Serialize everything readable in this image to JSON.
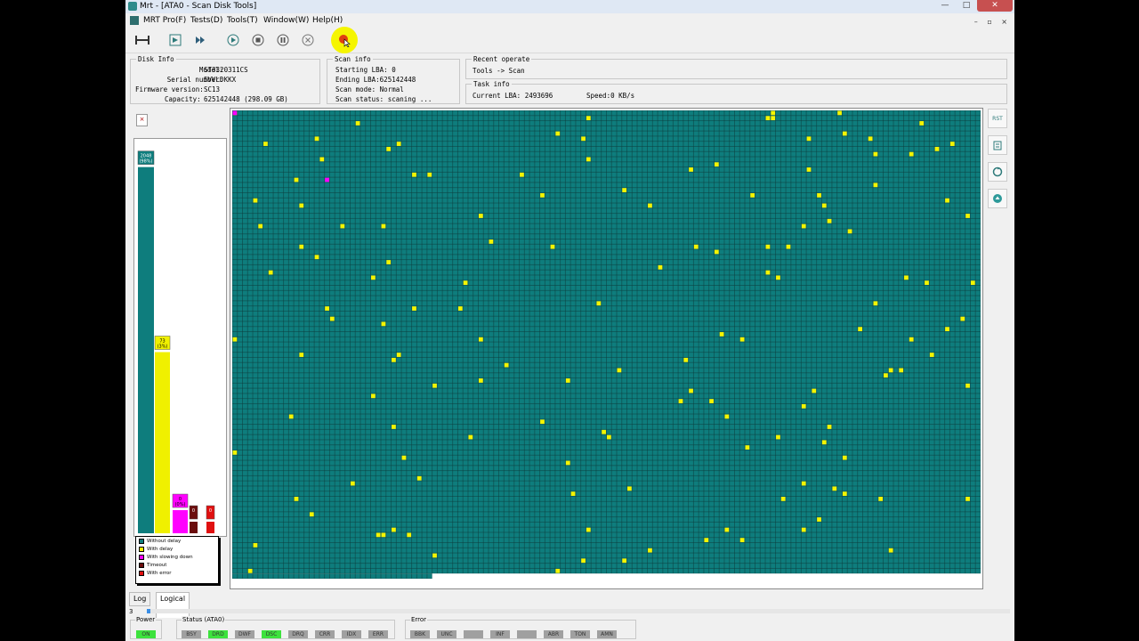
{
  "window": {
    "title": "Mrt - [ATA0 - Scan Disk Tools]",
    "controls": {
      "minimize": "—",
      "maximize": "□",
      "close": "✕"
    }
  },
  "menu": {
    "items": [
      "MRT Pro(F)",
      "Tests(D)",
      "Tools(T)",
      "Window(W)",
      "Help(H)"
    ],
    "mdi_controls": "– ▫ ×"
  },
  "disk_info": {
    "title": "Disk Info",
    "rows": [
      {
        "label": "Model:",
        "value": "ST3320311CS"
      },
      {
        "label": "Serial number:",
        "value": "5VVLDKKX"
      },
      {
        "label": "Firmware version:",
        "value": "SC13"
      },
      {
        "label": "Capacity:",
        "value": "625142448  (298.09 GB)"
      }
    ]
  },
  "scan_info": {
    "title": "Scan info",
    "rows": [
      "Starting LBA: 0",
      "Ending LBA:625142448",
      "Scan mode: Normal",
      "Scan status:  scaning ..."
    ]
  },
  "recent_operate": {
    "title": "Recent operate",
    "text": "Tools -> Scan"
  },
  "task_info": {
    "title": "Task info",
    "current_lba": "Current LBA: 2493696",
    "speed": "Speed:0 KB/s"
  },
  "histogram": {
    "bars": [
      {
        "name": "without-delay",
        "label": "2048\n(98%)",
        "color": "#0e7d7d",
        "level": 0.95
      },
      {
        "name": "with-delay",
        "label": "73\n(3%)",
        "color": "#f0f000",
        "level": 0.47
      },
      {
        "name": "slowing-down",
        "label": "0\n(0%)",
        "color": "#ff00ff",
        "level": 0.06
      },
      {
        "name": "timeout",
        "label": "0",
        "color": "#6b0d0d",
        "level": 0.03
      },
      {
        "name": "error",
        "label": "0",
        "color": "#e01010",
        "level": 0.03
      }
    ]
  },
  "legend": [
    {
      "label": "Without delay",
      "color": "#0e7d7d"
    },
    {
      "label": "With delay",
      "color": "#f0f000"
    },
    {
      "label": "With slowing down",
      "color": "#ff00ff"
    },
    {
      "label": "Timeout",
      "color": "#6b0d0d"
    },
    {
      "label": "With error",
      "color": "#e01010"
    }
  ],
  "scan_grid": {
    "colors": {
      "ok": "#0e7d7d",
      "delay": "#f5f500",
      "slow": "#ff00ff",
      "empty": "#ffffff"
    },
    "yellow_fraction": 0.01,
    "magenta_cells": [
      [
        0,
        0
      ],
      [
        18,
        13
      ]
    ]
  },
  "right_buttons": [
    "RST",
    "edit",
    "refresh",
    "eject"
  ],
  "tabs": [
    {
      "label": "Log"
    },
    {
      "label": "Logical scan"
    }
  ],
  "progress": {
    "text": "3",
    "fraction": 0.004
  },
  "status": {
    "power": {
      "title": "Power",
      "lamps": [
        {
          "label": "ON",
          "on": true
        }
      ]
    },
    "ata": {
      "title": "Status (ATA0)",
      "lamps": [
        {
          "label": "BSY",
          "on": false
        },
        {
          "label": "DRD",
          "on": true
        },
        {
          "label": "DWF",
          "on": false
        },
        {
          "label": "DSC",
          "on": true
        },
        {
          "label": "DRQ",
          "on": false
        },
        {
          "label": "CRR",
          "on": false
        },
        {
          "label": "IDX",
          "on": false
        },
        {
          "label": "ERR",
          "on": false
        }
      ]
    },
    "error": {
      "title": "Error",
      "lamps": [
        {
          "label": "BBK",
          "on": false
        },
        {
          "label": "UNC",
          "on": false
        },
        {
          "label": "",
          "on": false
        },
        {
          "label": "INF",
          "on": false
        },
        {
          "label": "",
          "on": false
        },
        {
          "label": "ABR",
          "on": false
        },
        {
          "label": "TON",
          "on": false
        },
        {
          "label": "AMN",
          "on": false
        }
      ]
    }
  }
}
